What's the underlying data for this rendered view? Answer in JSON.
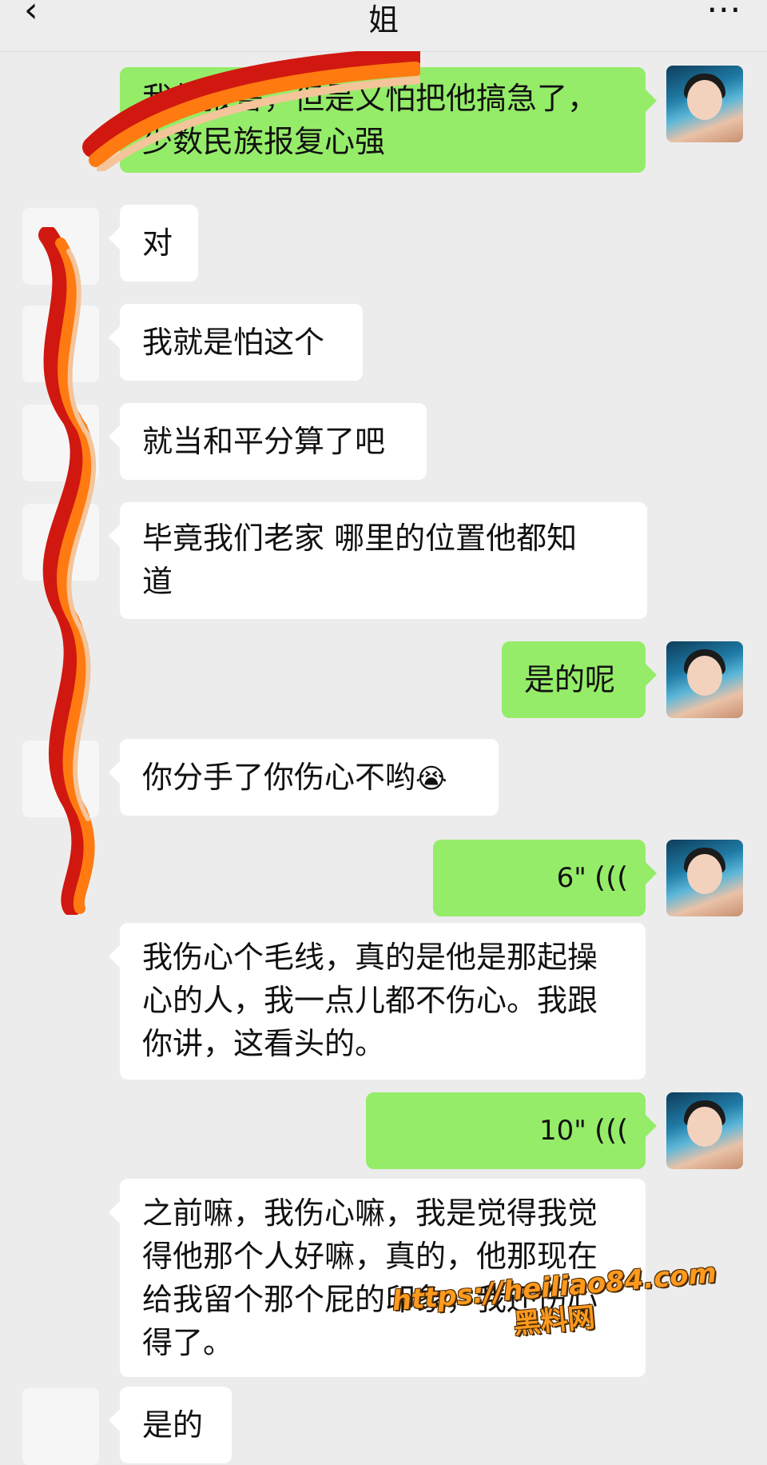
{
  "header": {
    "back_icon": "‹",
    "title": "姐",
    "more_icon": "⋯"
  },
  "messages": [
    {
      "sender": "me",
      "type": "text",
      "lines": [
        "我想报警，但是又怕把他搞急了，",
        "少数民族报复心强"
      ]
    },
    {
      "sender": "other",
      "type": "text",
      "lines": [
        "对"
      ]
    },
    {
      "sender": "other",
      "type": "text",
      "lines": [
        "我就是怕这个"
      ]
    },
    {
      "sender": "other",
      "type": "text",
      "lines": [
        "就当和平分算了吧"
      ]
    },
    {
      "sender": "other",
      "type": "text",
      "lines": [
        "毕竟我们老家  哪里的位置他都知",
        "道"
      ]
    },
    {
      "sender": "me",
      "type": "text",
      "lines": [
        "是的呢"
      ]
    },
    {
      "sender": "other",
      "type": "text",
      "lines": [
        "你分手了你伤心不哟"
      ],
      "emoji": "😭"
    },
    {
      "sender": "me",
      "type": "voice",
      "duration": "6\""
    },
    {
      "sender": "other",
      "type": "text",
      "lines": [
        "我伤心个毛线，真的是他是那起操",
        "心的人，我一点儿都不伤心。我跟",
        "你讲，这看头的。"
      ]
    },
    {
      "sender": "me",
      "type": "voice",
      "duration": "10\""
    },
    {
      "sender": "other",
      "type": "text",
      "lines": [
        "之前嘛，我伤心嘛，我是觉得我觉",
        "得他那个人好嘛，真的，他那现在",
        "给我留个那个屁的印象，我还伤心",
        "得了。"
      ]
    },
    {
      "sender": "other",
      "type": "text",
      "lines": [
        "是的"
      ]
    }
  ],
  "watermark": {
    "url": "https://heiliao84.com",
    "name": "黑料网"
  },
  "colors": {
    "my_bubble": "#95ec69",
    "other_bubble": "#ffffff",
    "background": "#ececec"
  },
  "icons": {
    "voice": "voice-wave-icon",
    "back": "chevron-left-icon",
    "more": "more-dots-icon"
  }
}
